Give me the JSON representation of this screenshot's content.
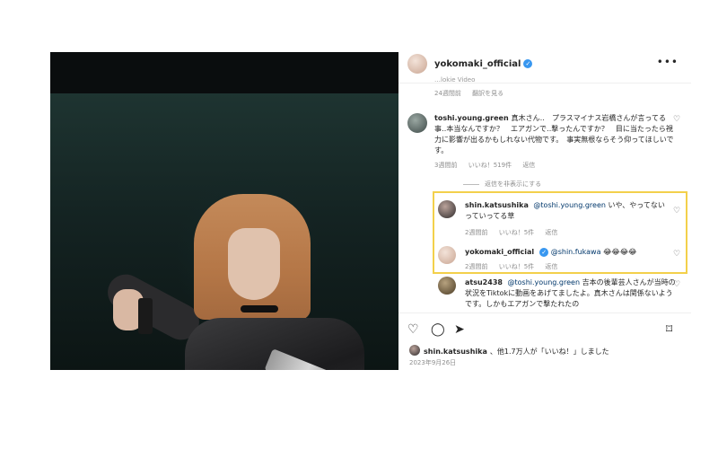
{
  "post": {
    "image_alt": "Woman with orange bob haircut holding a gun",
    "next_icon": "›",
    "dots": [
      true,
      false,
      false,
      false
    ]
  },
  "header": {
    "username": "yokomaki_official",
    "verified": "✓",
    "more": "•••"
  },
  "comments": {
    "first": {
      "cut_text": "…lokie Video",
      "time": "24週間前",
      "translate": "翻訳を見る"
    },
    "second": {
      "username": "toshi.young.green",
      "text": "真木さん‥　プラスマイナス岩橋さんが言ってる事‥本当なんですか？　エアガンで‥撃ったんですか？　目に当たったら視力に影響が出るかもしれない代物です。　事実無根ならそう仰ってほしいです。",
      "time": "3週間前",
      "likes": "いいね！519件",
      "reply": "返信"
    },
    "hide_replies": "返信を非表示にする",
    "replies": [
      {
        "username": "shin.katsushika",
        "mention": "@toshi.young.green",
        "text": "いや、やってないっていってる草",
        "time": "2週間前",
        "likes": "いいね！5件",
        "reply": "返信"
      },
      {
        "username": "yokomaki_official",
        "verified": "✓",
        "mention": "@shin.fukawa",
        "text": "😂😂😂😂",
        "time": "2週間前",
        "likes": "いいね！5件",
        "reply": "返信"
      }
    ],
    "third": {
      "username": "atsu2438",
      "mention": "@toshi.young.green",
      "text": "吉本の後輩芸人さんが当時の状況をTiktokに動画をあげてましたよ。真木さんは関係ないようです。しかもエアガンで撃たれたの"
    }
  },
  "actions": {
    "like_icon": "♡",
    "comment_icon": "◯",
    "share_icon": "➤",
    "save_icon": "⌑"
  },
  "liked_by": {
    "username": "shin.katsushika",
    "text": "、他1.7万人が「いいね！」しました"
  },
  "date": "2023年9月26日",
  "heart_icon": "♡"
}
